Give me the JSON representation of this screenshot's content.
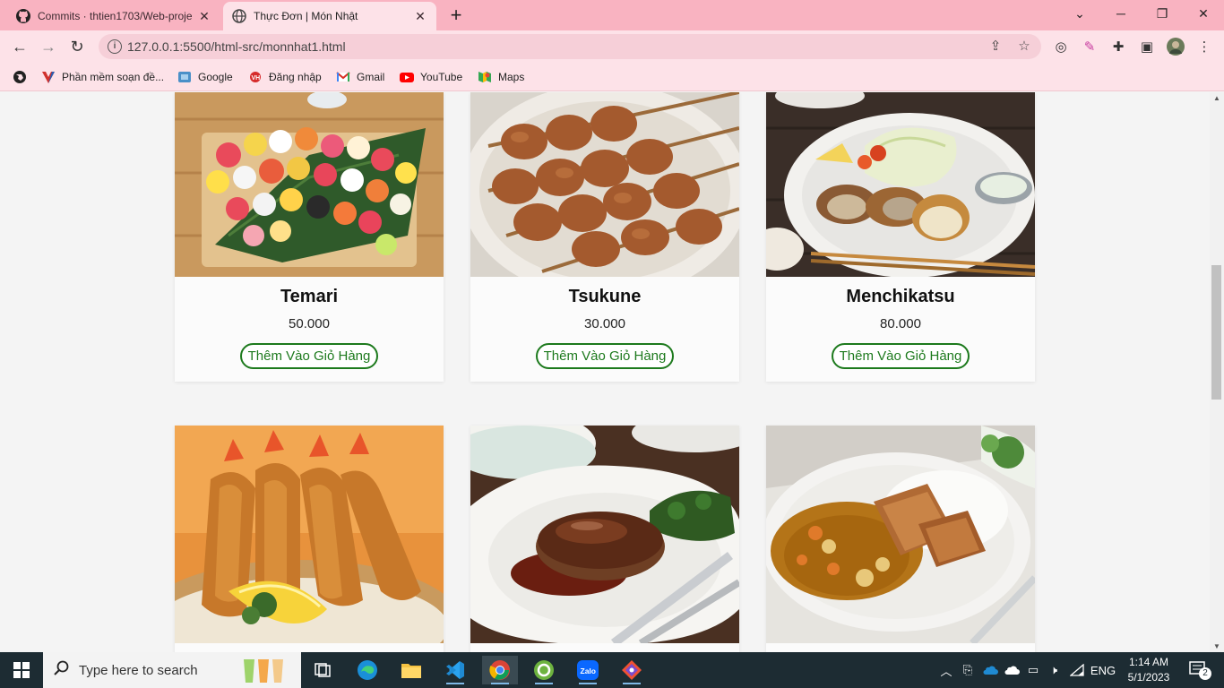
{
  "browser": {
    "tabs": [
      {
        "title": "Commits · thtien1703/Web-proje",
        "active": false
      },
      {
        "title": "Thực Đơn | Món Nhật",
        "active": true
      }
    ],
    "url": "127.0.0.1:5500/html-src/monnhat1.html",
    "bookmarks": [
      {
        "label": "Phần mềm soạn đề..."
      },
      {
        "label": "Google"
      },
      {
        "label": "Đăng nhập"
      },
      {
        "label": "Gmail"
      },
      {
        "label": "YouTube"
      },
      {
        "label": "Maps"
      }
    ]
  },
  "menu": {
    "add_label": "Thêm Vào Giỏ Hàng",
    "items": [
      {
        "name": "Temari",
        "price": "50.000"
      },
      {
        "name": "Tsukune",
        "price": "30.000"
      },
      {
        "name": "Menchikatsu",
        "price": "80.000"
      },
      {
        "name": "",
        "price": ""
      },
      {
        "name": "",
        "price": ""
      },
      {
        "name": "",
        "price": ""
      }
    ]
  },
  "taskbar": {
    "search_placeholder": "Type here to search",
    "language": "ENG",
    "time": "1:14 AM",
    "date": "5/1/2023",
    "notifications": "2"
  }
}
